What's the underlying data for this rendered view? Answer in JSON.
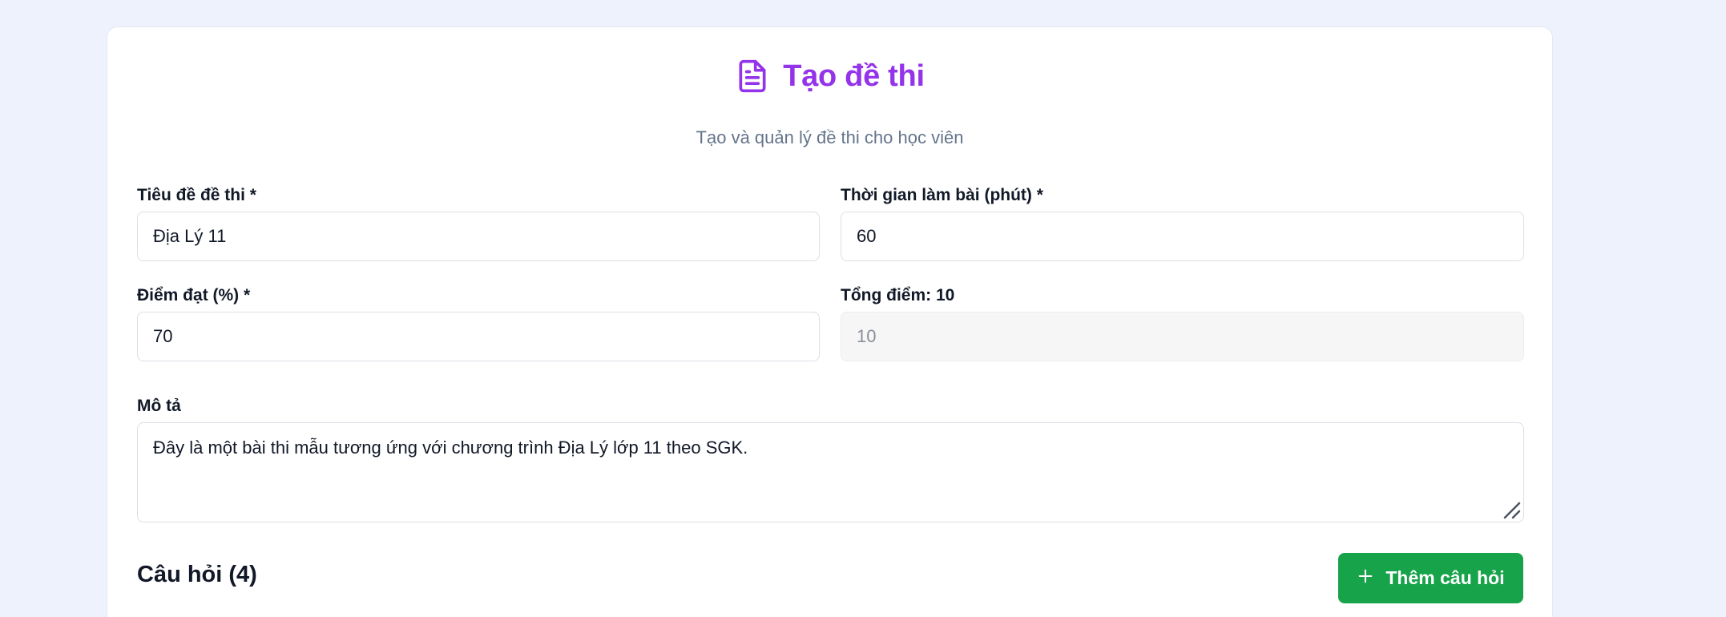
{
  "header": {
    "title": "Tạo đề thi",
    "subtitle": "Tạo và quản lý đề thi cho học viên",
    "icon": "file-text-icon",
    "accent_color": "#9333ea"
  },
  "form": {
    "title_label": "Tiêu đề đề thi *",
    "title_value": "Địa Lý 11",
    "duration_label": "Thời gian làm bài (phút) *",
    "duration_value": "60",
    "pass_label": "Điểm đạt (%) *",
    "pass_value": "70",
    "total_label": "Tổng điểm: 10",
    "total_value": "10",
    "description_label": "Mô tả",
    "description_value": "Đây là một bài thi mẫu tương ứng với chương trình Địa Lý lớp 11 theo SGK."
  },
  "questions": {
    "heading": "Câu hỏi (4)",
    "add_button_label": "Thêm câu hỏi",
    "add_button_icon": "plus-icon",
    "button_color": "#16a34a"
  }
}
